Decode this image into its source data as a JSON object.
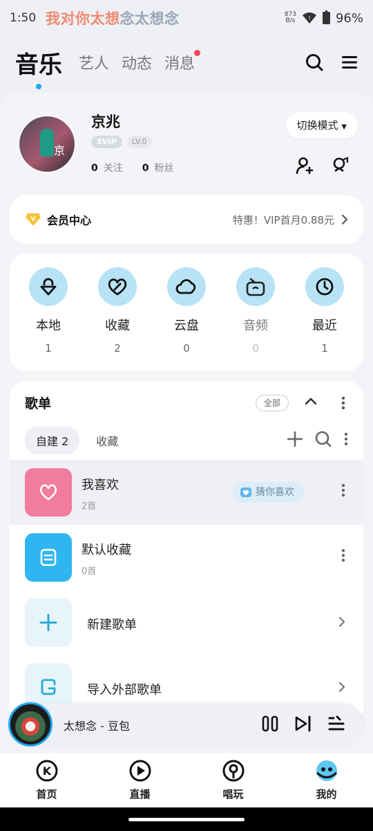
{
  "status_bar": {
    "time": "1:50",
    "lyric_highlight": "我对你太想",
    "lyric_rest": "念太想念",
    "net_speed_value": "873",
    "net_speed_unit": "B/s",
    "battery": "96%"
  },
  "top_nav": {
    "tabs": [
      {
        "label": "音乐"
      },
      {
        "label": "艺人"
      },
      {
        "label": "动态"
      },
      {
        "label": "消息"
      }
    ]
  },
  "profile": {
    "avatar_badge": "京",
    "username": "京兆",
    "svip": "SVIP",
    "level": "LV.0",
    "following_count": "0",
    "following_label": "关注",
    "fans_count": "0",
    "fans_label": "粉丝",
    "mode_button": "切换模式"
  },
  "vip": {
    "title": "会员中心",
    "promo": "特惠！VIP首月0.88元"
  },
  "quick_access": [
    {
      "label": "本地",
      "count": "1"
    },
    {
      "label": "收藏",
      "count": "2"
    },
    {
      "label": "云盘",
      "count": "0"
    },
    {
      "label": "音频",
      "count": "0"
    },
    {
      "label": "最近",
      "count": "1"
    }
  ],
  "playlists": {
    "title": "歌单",
    "all_label": "全部",
    "tabs": [
      {
        "label": "自建 2"
      },
      {
        "label": "收藏"
      }
    ],
    "items": [
      {
        "title": "我喜欢",
        "count": "2首",
        "tag": "猜你喜欢"
      },
      {
        "title": "默认收藏",
        "count": "0首"
      },
      {
        "title": "新建歌单"
      },
      {
        "title": "导入外部歌单"
      }
    ]
  },
  "player": {
    "track": "太想念  -  豆包"
  },
  "bottom_nav": [
    {
      "label": "首页"
    },
    {
      "label": "直播"
    },
    {
      "label": "唱玩"
    },
    {
      "label": "我的"
    }
  ],
  "colors": {
    "accent": "#1ea6f0",
    "like_cover": "#f27ca0",
    "collect_cover": "#2fb6f0",
    "quick_circle": "#b8e3f6"
  }
}
